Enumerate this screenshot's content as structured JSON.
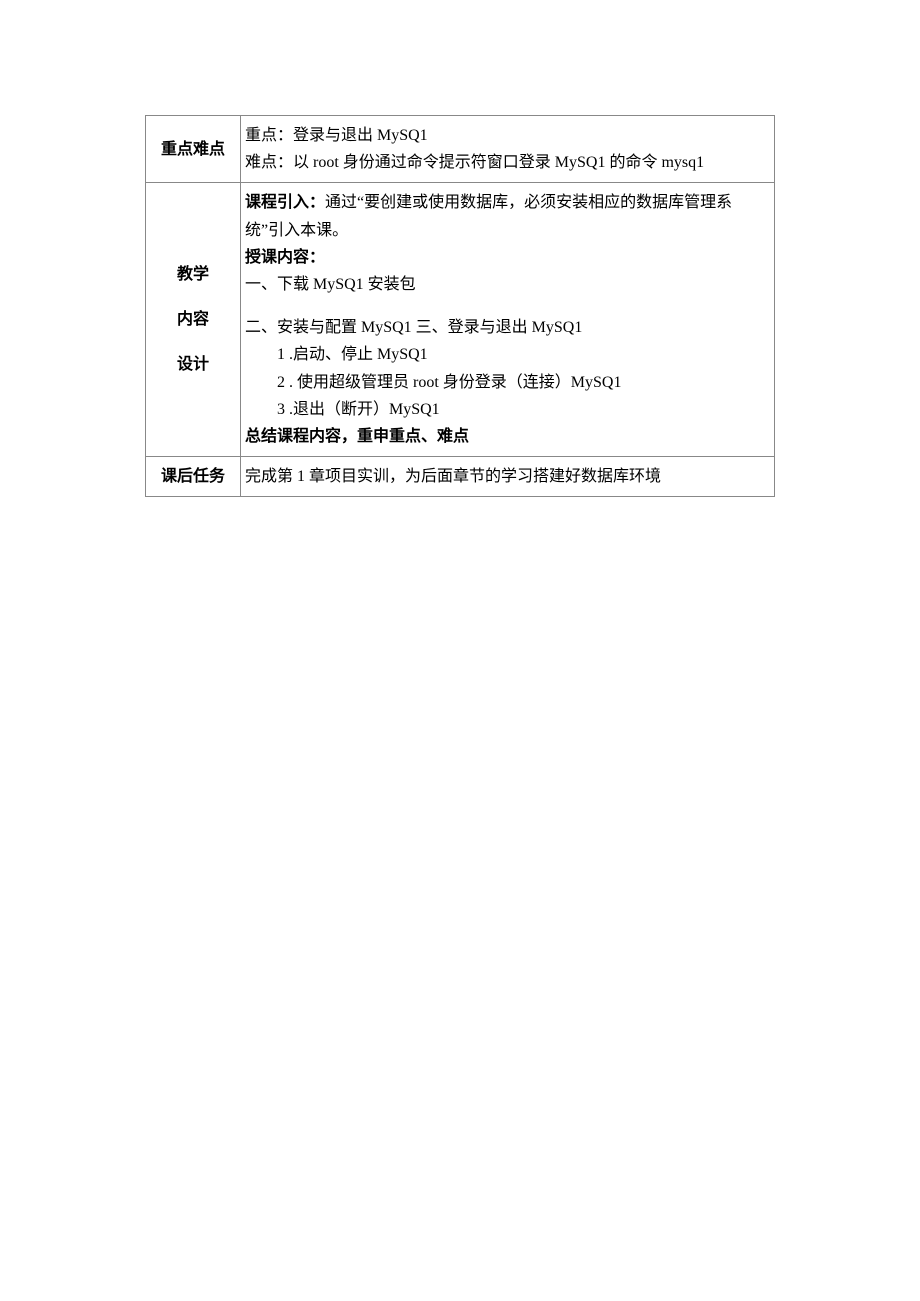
{
  "rows": {
    "r1": {
      "label": "重点难点",
      "line1": "重点：登录与退出 MySQ1",
      "line2": "难点：以 root 身份通过命令提示符窗口登录 MySQ1 的命令 mysq1"
    },
    "r2": {
      "label1": "教学",
      "label2": "内容",
      "label3": "设计",
      "intro_label": "课程引入：",
      "intro_text": "通过“要创建或使用数据库，必须安装相应的数据库管理系统”引入本课。",
      "teach_label": "授课内容：",
      "sec1": "一、下载 MySQ1 安装包",
      "sec2": "二、安装与配置 MySQ1 三、登录与退出 MySQ1",
      "item1": "1 .启动、停止 MySQ1",
      "item2": "2 . 使用超级管理员 root 身份登录（连接）MySQ1",
      "item3": "3 .退出（断开）MySQ1",
      "summary": "总结课程内容，重申重点、难点"
    },
    "r3": {
      "label": "课后任务",
      "text": "完成第 1 章项目实训，为后面章节的学习搭建好数据库环境"
    }
  }
}
